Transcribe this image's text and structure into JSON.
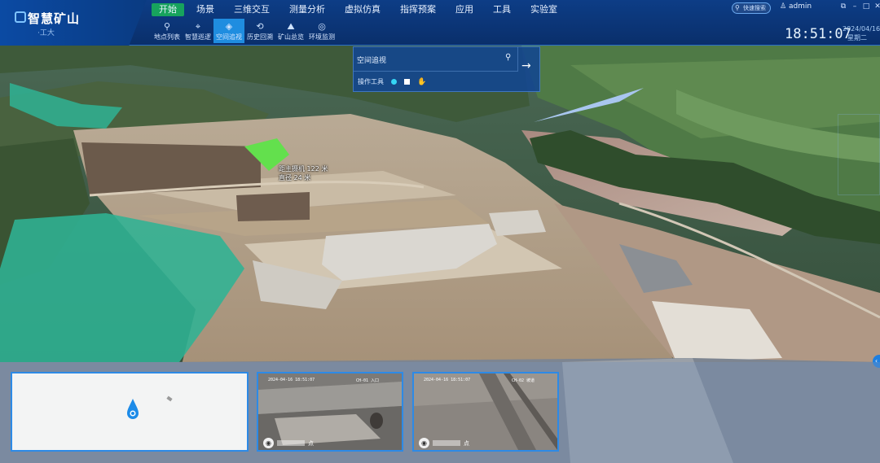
{
  "app": {
    "title": "智慧矿山",
    "subtitle": "·工大"
  },
  "top_nav": [
    {
      "label": "开始",
      "active": true
    },
    {
      "label": "场景",
      "active": false
    },
    {
      "label": "三维交互",
      "active": false
    },
    {
      "label": "测量分析",
      "active": false
    },
    {
      "label": "虚拟仿真",
      "active": false
    },
    {
      "label": "指挥预案",
      "active": false
    },
    {
      "label": "应用",
      "active": false
    },
    {
      "label": "工具",
      "active": false
    },
    {
      "label": "实验室",
      "active": false
    }
  ],
  "sub_nav": [
    {
      "label": "地点列表",
      "icon": "location-list-icon",
      "active": false
    },
    {
      "label": "智慧巡逻",
      "icon": "patrol-icon",
      "active": false
    },
    {
      "label": "空间追视",
      "icon": "space-track-icon",
      "active": true
    },
    {
      "label": "历史回溯",
      "icon": "history-icon",
      "active": false
    },
    {
      "label": "矿山总览",
      "icon": "overview-icon",
      "active": false
    },
    {
      "label": "环境监测",
      "icon": "environment-icon",
      "active": false
    }
  ],
  "header_right": {
    "search_placeholder": "快速搜索",
    "user": "admin",
    "time": "18:51:07",
    "date": "2024/04/16",
    "weekday": "星期二"
  },
  "query_panel": {
    "placeholder": "空间追视",
    "tools_label": "操作工具"
  },
  "measure_label": {
    "line1": "距主摄机 122 米",
    "line2": "直径 24 米"
  },
  "cameras": [
    {
      "timestamp": "2024-04-16 18:51:07",
      "channel": "CH-01 入口",
      "label": "点"
    },
    {
      "timestamp": "2024-04-16 18:51:07",
      "channel": "CH-02 坡道",
      "label": "点"
    }
  ],
  "colors": {
    "header_bg": "#0d3d86",
    "active_nav": "#17a35d",
    "active_subnav": "#1f8de0",
    "panel_border": "#2d8ae6",
    "zone_teal": "#2fb394",
    "zone_green": "#63e04d"
  }
}
